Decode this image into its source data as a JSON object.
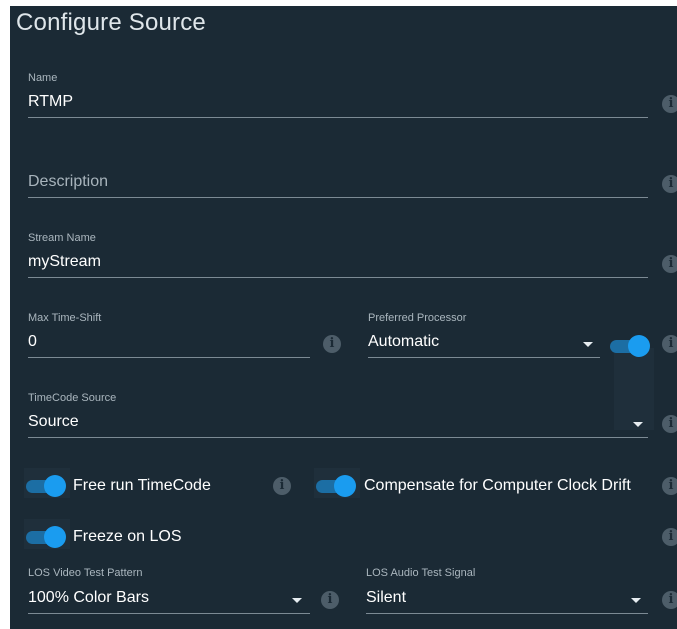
{
  "dialog": {
    "title": "Configure Source"
  },
  "fields": {
    "name": {
      "label": "Name",
      "value": "RTMP"
    },
    "description": {
      "placeholder": "Description"
    },
    "stream_name": {
      "label": "Stream Name",
      "value": "myStream"
    },
    "max_time_shift": {
      "label": "Max Time-Shift",
      "value": "0"
    },
    "preferred_processor": {
      "label": "Preferred Processor",
      "value": "Automatic",
      "enabled": true
    },
    "timecode_source": {
      "label": "TimeCode Source",
      "value": "Source"
    },
    "los_video": {
      "label": "LOS Video Test Pattern",
      "value": "100% Color Bars"
    },
    "los_audio": {
      "label": "LOS Audio Test Signal",
      "value": "Silent"
    }
  },
  "toggles": {
    "free_run": {
      "label": "Free run TimeCode",
      "on": true
    },
    "clock_drift": {
      "label": "Compensate for Computer Clock Drift",
      "on": true
    },
    "freeze_los": {
      "label": "Freeze on LOS",
      "on": true
    }
  },
  "icons": {
    "info": "i",
    "dropdown": "caret-down-icon"
  },
  "colors": {
    "background": "#1b2a35",
    "accent": "#1a9cf0",
    "track": "#1c6ea4"
  }
}
